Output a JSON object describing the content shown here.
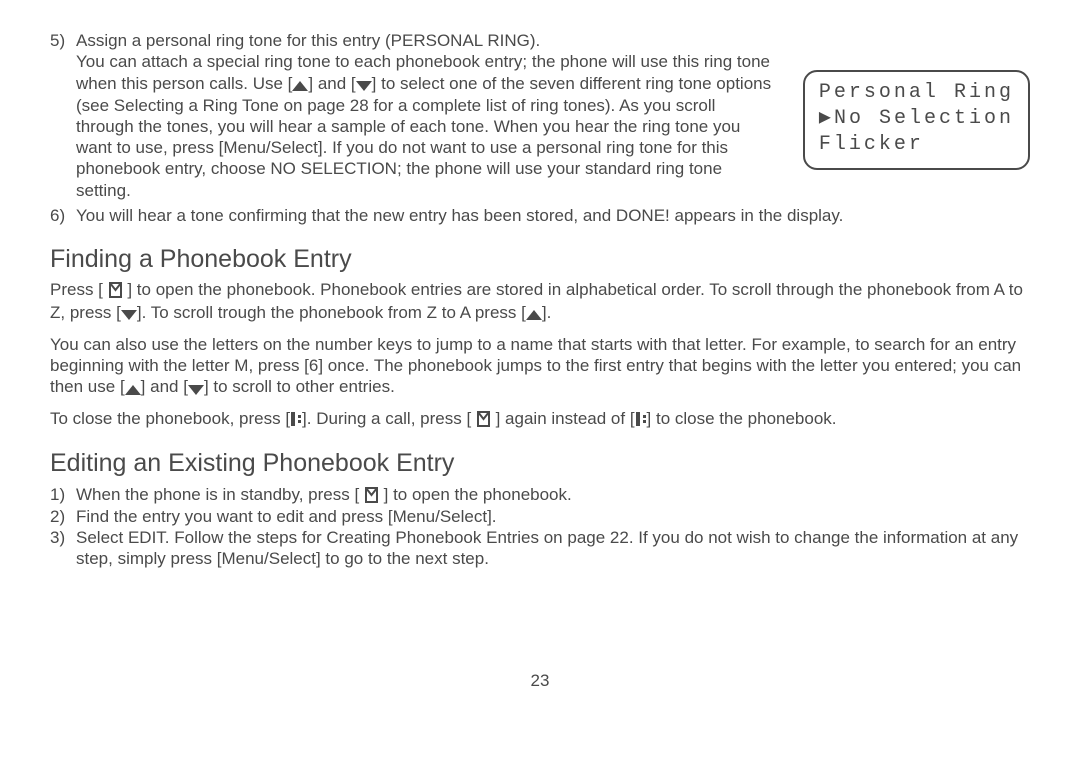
{
  "step5": {
    "num": "5)",
    "title_line": "Assign a personal ring tone for this entry (PERSONAL RING).",
    "body_a": "You can attach a special ring tone to each phonebook entry; the phone will use this ring tone when this person calls. Use [",
    "body_b": "] and [",
    "body_c": "]  to select one of the seven different ring tone options (see Selecting a Ring Tone on page 28 for a complete list of ring tones). As you scroll through the tones, you will hear a sample of each tone. When you hear  the ring tone you want to use, press [Menu/Select]. If you do not want to use a personal ring tone for this phonebook entry, choose NO SELECTION; the phone will use your standard ring tone setting."
  },
  "display": {
    "line1": "Personal Ring",
    "line2_prefix": "▶",
    "line2": "No Selection",
    "line3": "Flicker"
  },
  "step6": {
    "num": "6)",
    "text": "You will hear a tone confirming that the new entry has been stored, and DONE! appears in the display."
  },
  "finding": {
    "heading": "Finding a Phonebook Entry",
    "p1a": "Press [ ",
    "p1b": " ] to open the phonebook. Phonebook entries are stored in alphabetical order. To scroll through the phonebook from A to Z, press [",
    "p1c": "]. To scroll trough the phonebook from Z to A press [",
    "p1d": "].",
    "p2a": "You can also use the letters on the number keys to jump to a name that starts with that letter. For example, to search for an entry beginning with the letter M, press [6] once. The phonebook jumps to the first entry that begins with the letter you entered; you can then use [",
    "p2b": "] and [",
    "p2c": "] to scroll to other entries.",
    "p3a": "To close the phonebook, press [",
    "p3b": "]. During a call, press [ ",
    "p3c": " ] again instead of [",
    "p3d": "] to close the phonebook."
  },
  "editing": {
    "heading": "Editing an Existing Phonebook Entry",
    "s1num": "1)",
    "s1a": "When the phone is in standby, press [ ",
    "s1b": " ] to open the phonebook.",
    "s2num": "2)",
    "s2": "Find the entry you want to edit and press [Menu/Select].",
    "s3num": "3)",
    "s3": "Select EDIT. Follow the steps for Creating Phonebook Entries on page 22. If you do not wish to change the information at any step, simply press [Menu/Select] to go to the next step."
  },
  "pagenum": "23"
}
